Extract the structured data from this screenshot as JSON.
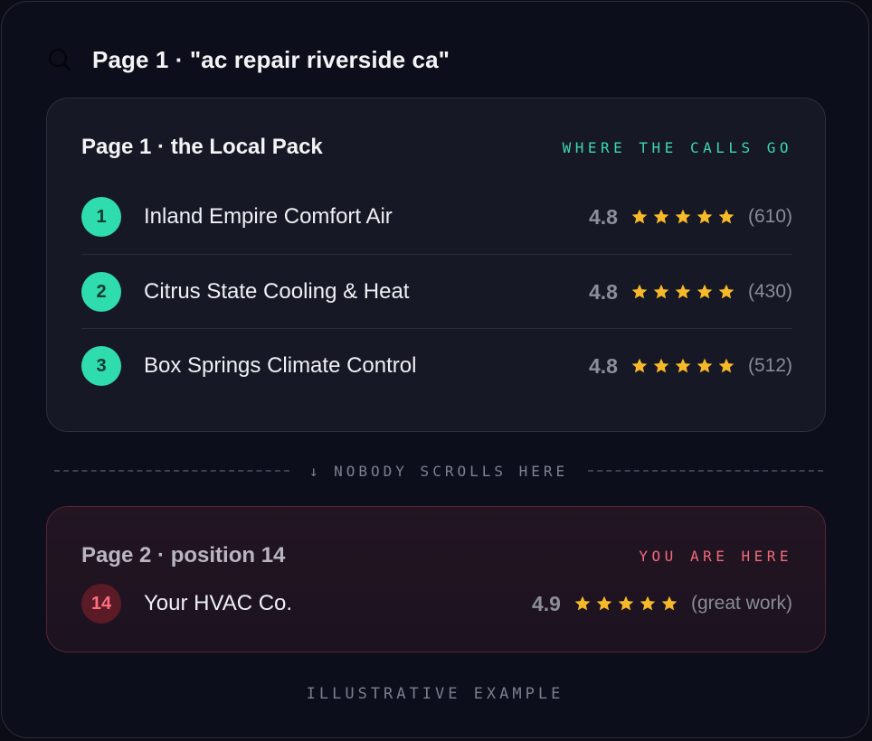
{
  "search": {
    "query_label": "Page 1 · \"ac repair riverside ca\""
  },
  "local_pack": {
    "title": "Page 1 · the Local Pack",
    "tag": "WHERE THE CALLS GO",
    "results": [
      {
        "rank": "1",
        "name": "Inland Empire Comfort Air",
        "rating": "4.8",
        "stars": 5,
        "reviews": "(610)"
      },
      {
        "rank": "2",
        "name": "Citrus State Cooling & Heat",
        "rating": "4.8",
        "stars": 5,
        "reviews": "(430)"
      },
      {
        "rank": "3",
        "name": "Box Springs Climate Control",
        "rating": "4.8",
        "stars": 5,
        "reviews": "(512)"
      }
    ]
  },
  "divider": {
    "label": "↓ NOBODY SCROLLS HERE"
  },
  "your_listing": {
    "title": "Page 2 · position 14",
    "tag": "YOU ARE HERE",
    "rank": "14",
    "name": "Your HVAC Co.",
    "rating": "4.9",
    "stars": 5,
    "reviews": "(great work)"
  },
  "footer": {
    "note": "ILLUSTRATIVE EXAMPLE"
  },
  "colors": {
    "accent_green": "#2fdcae",
    "accent_red": "#f06a7c",
    "star_yellow": "#f7b928",
    "background": "#0d0e1b"
  },
  "icons": {
    "search": "search-icon",
    "star": "star-icon"
  }
}
